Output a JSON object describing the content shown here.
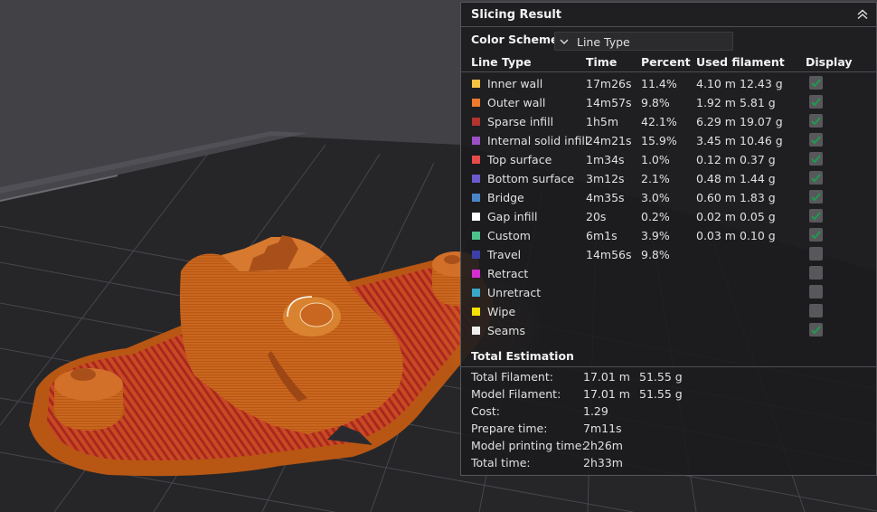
{
  "panel": {
    "title": "Slicing Result",
    "color_scheme_label": "Color Scheme",
    "color_scheme_value": "Line Type",
    "headers": {
      "line_type": "Line Type",
      "time": "Time",
      "percent": "Percent",
      "used_filament": "Used filament",
      "display": "Display"
    },
    "rows": [
      {
        "name": "Inner wall",
        "color": "#f5c242",
        "time": "17m26s",
        "percent": "11.4%",
        "meters": "4.10 m",
        "grams": "12.43 g",
        "checked": true
      },
      {
        "name": "Outer wall",
        "color": "#ee7a2d",
        "time": "14m57s",
        "percent": "9.8%",
        "meters": "1.92 m",
        "grams": "5.81 g",
        "checked": true
      },
      {
        "name": "Sparse infill",
        "color": "#b1342e",
        "time": "1h5m",
        "percent": "42.1%",
        "meters": "6.29 m",
        "grams": "19.07 g",
        "checked": true
      },
      {
        "name": "Internal solid infill",
        "color": "#9b4fc4",
        "time": "24m21s",
        "percent": "15.9%",
        "meters": "3.45 m",
        "grams": "10.46 g",
        "checked": true
      },
      {
        "name": "Top surface",
        "color": "#e64b4b",
        "time": "1m34s",
        "percent": "1.0%",
        "meters": "0.12 m",
        "grams": "0.37 g",
        "checked": true
      },
      {
        "name": "Bottom surface",
        "color": "#6a5acd",
        "time": "3m12s",
        "percent": "2.1%",
        "meters": "0.48 m",
        "grams": "1.44 g",
        "checked": true
      },
      {
        "name": "Bridge",
        "color": "#4a86c7",
        "time": "4m35s",
        "percent": "3.0%",
        "meters": "0.60 m",
        "grams": "1.83 g",
        "checked": true
      },
      {
        "name": "Gap infill",
        "color": "#ffffff",
        "time": "20s",
        "percent": "0.2%",
        "meters": "0.02 m",
        "grams": "0.05 g",
        "checked": true
      },
      {
        "name": "Custom",
        "color": "#4cc38a",
        "time": "6m1s",
        "percent": "3.9%",
        "meters": "0.03 m",
        "grams": "0.10 g",
        "checked": true
      },
      {
        "name": "Travel",
        "color": "#3c3fa8",
        "time": "14m56s",
        "percent": "9.8%",
        "meters": "",
        "grams": "",
        "checked": false
      },
      {
        "name": "Retract",
        "color": "#d42ed1",
        "time": "",
        "percent": "",
        "meters": "",
        "grams": "",
        "checked": false
      },
      {
        "name": "Unretract",
        "color": "#3aa7c9",
        "time": "",
        "percent": "",
        "meters": "",
        "grams": "",
        "checked": false
      },
      {
        "name": "Wipe",
        "color": "#f5e000",
        "time": "",
        "percent": "",
        "meters": "",
        "grams": "",
        "checked": false
      },
      {
        "name": "Seams",
        "color": "#eeeeee",
        "time": "",
        "percent": "",
        "meters": "",
        "grams": "",
        "checked": true
      }
    ],
    "total_title": "Total Estimation",
    "totals": [
      {
        "label": "Total Filament:",
        "v1": "17.01 m",
        "v2": "51.55 g"
      },
      {
        "label": "Model Filament:",
        "v1": "17.01 m",
        "v2": "51.55 g"
      },
      {
        "label": "Cost:",
        "v1": "1.29",
        "v2": ""
      },
      {
        "label": "Prepare time:",
        "v1": "7m11s",
        "v2": ""
      },
      {
        "label": "Model printing time:",
        "v1": "2h26m",
        "v2": ""
      },
      {
        "label": "Total time:",
        "v1": "2h33m",
        "v2": ""
      }
    ],
    "colors": {
      "check": "#1f9a4e",
      "checkbox_bg": "#58585c"
    }
  },
  "viewport": {
    "colors": {
      "plate": "#252528",
      "grid": "#47474d",
      "model_orange": "#c9661f",
      "infill_red": "#b6352c"
    }
  }
}
